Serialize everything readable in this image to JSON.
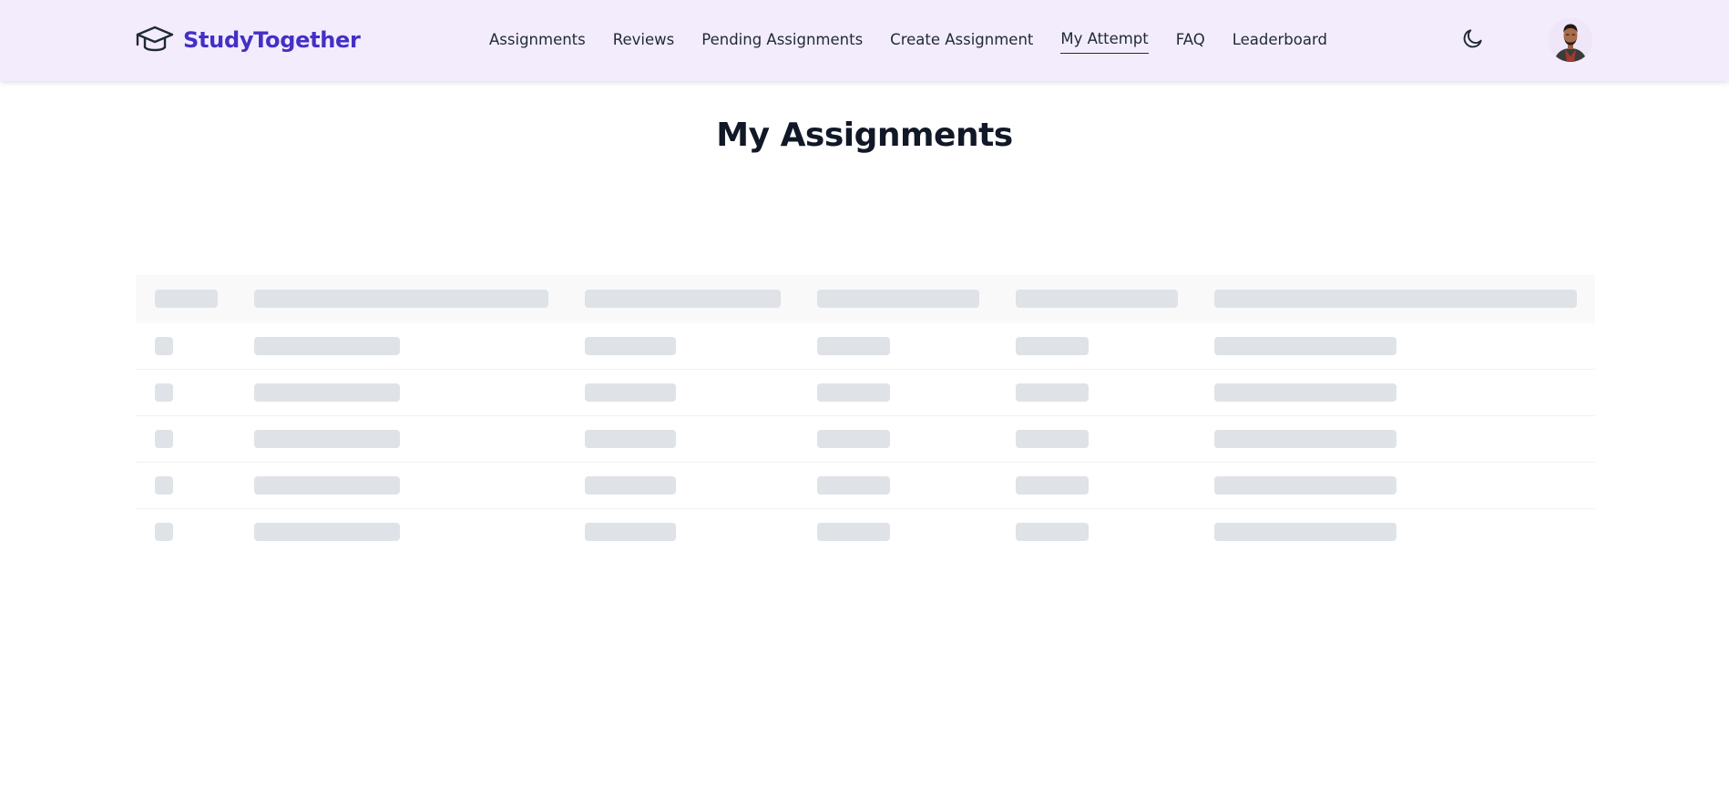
{
  "brand": {
    "name": "StudyTogether",
    "icon": "graduation-cap-icon",
    "color": "#4330c5"
  },
  "nav": {
    "links": [
      {
        "label": "Assignments",
        "active": false
      },
      {
        "label": "Reviews",
        "active": false
      },
      {
        "label": "Pending Assignments",
        "active": false
      },
      {
        "label": "Create Assignment",
        "active": false
      },
      {
        "label": "My Attempt",
        "active": true
      },
      {
        "label": "FAQ",
        "active": false
      },
      {
        "label": "Leaderboard",
        "active": false
      }
    ],
    "theme_toggle_icon": "moon-icon",
    "background": "#f3ecfd"
  },
  "user": {
    "avatar_icon": "user-avatar"
  },
  "main": {
    "title": "My Assignments",
    "table": {
      "state": "loading-skeleton",
      "columns": 6,
      "skeleton_rows": 5,
      "skeleton_color": "#dfe2e6"
    }
  }
}
